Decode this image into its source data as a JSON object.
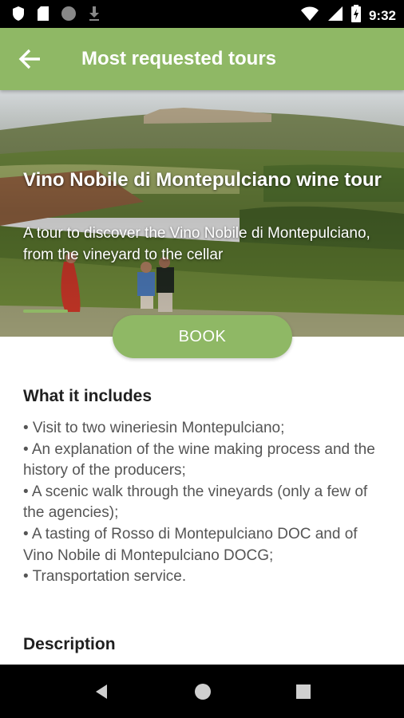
{
  "status_bar": {
    "time": "9:32",
    "left_icons": [
      "shield-icon",
      "sd-card-icon",
      "circle-icon",
      "download-icon"
    ],
    "right_icons": [
      "wifi-icon",
      "signal-icon",
      "battery-icon"
    ]
  },
  "app_bar": {
    "title": "Most requested tours",
    "back_icon": "arrow-left-icon"
  },
  "hero": {
    "title": "Vino Nobile di Montepulciano wine tour",
    "subtitle": "A tour to discover the Vino Nobile di Montepulciano, from the vineyard to the cellar"
  },
  "book_button": {
    "label": "BOOK"
  },
  "includes": {
    "heading": "What it includes",
    "items": [
      "• Visit to two wineriesin Montepulciano;",
      "• An explanation of the wine making process and the history of the producers;",
      "• A scenic walk through the vineyards (only a few of the agencies);",
      "• A tasting of Rosso di Montepulciano DOC and of Vino Nobile di Montepulciano DOCG;",
      "• Transportation service."
    ]
  },
  "description": {
    "heading": "Description"
  },
  "nav_bar": {
    "icons": [
      "back-triangle-icon",
      "home-circle-icon",
      "recents-square-icon"
    ]
  },
  "colors": {
    "accent": "#8fb865",
    "text_dark": "#1f1f1f",
    "text_body": "#555555"
  }
}
